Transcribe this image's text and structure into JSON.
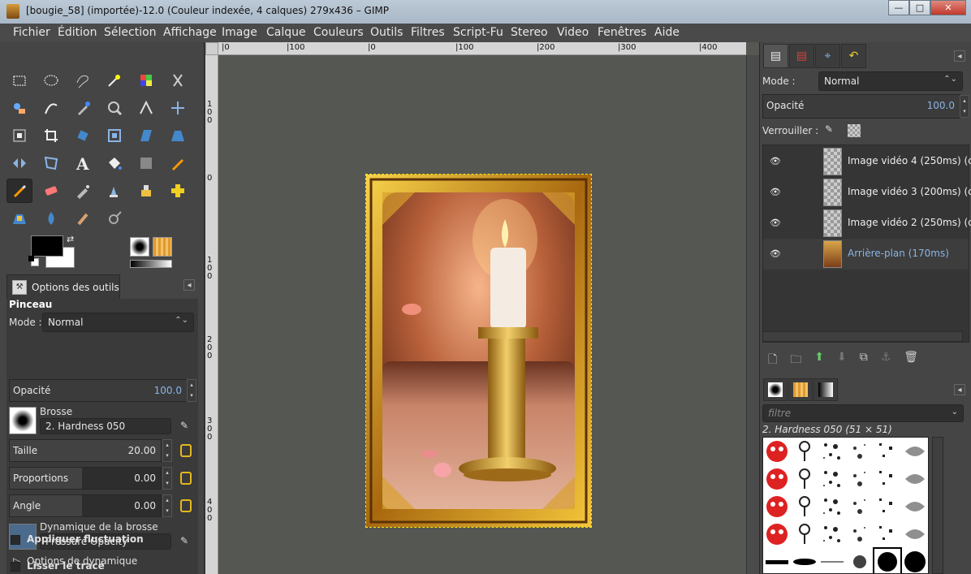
{
  "window": {
    "title": "[bougie_58] (importée)-12.0 (Couleur indexée, 4 calques) 279x436 – GIMP",
    "controls": {
      "minimize": "—",
      "maximize": "□",
      "close": "✕"
    }
  },
  "menu": [
    "Fichier",
    "Édition",
    "Sélection",
    "Affichage",
    "Image",
    "Calque",
    "Couleurs",
    "Outils",
    "Filtres",
    "Script-Fu",
    "Stereo",
    "Video",
    "Fenêtres",
    "Aide"
  ],
  "tools": [
    "rect-select-icon",
    "ellipse-select-icon",
    "free-select-icon",
    "fuzzy-select-icon",
    "color-select-icon",
    "scissors-icon",
    "foreground-select-icon",
    "paths-icon",
    "color-picker-icon",
    "zoom-icon",
    "measure-icon",
    "move-icon",
    "align-icon",
    "crop-icon",
    "rotate-icon",
    "scale-icon",
    "shear-icon",
    "perspective-icon",
    "flip-icon",
    "cage-icon",
    "text-icon",
    "bucket-fill-icon",
    "blend-icon",
    "pencil-icon",
    "paintbrush-icon",
    "eraser-icon",
    "airbrush-icon",
    "ink-icon",
    "clone-icon",
    "heal-icon",
    "perspective-clone-icon",
    "blur-icon",
    "smudge-icon",
    "dodge-burn-icon"
  ],
  "tool_options": {
    "tab_label": "Options des outils",
    "tool_name": "Pinceau",
    "mode_label": "Mode :",
    "mode_value": "Normal",
    "opacity_label": "Opacité",
    "opacity_value": "100.0",
    "brush_label": "Brosse",
    "brush_value": "2. Hardness 050",
    "size_label": "Taille",
    "size_value": "20.00",
    "aspect_label": "Proportions",
    "aspect_value": "0.00",
    "angle_label": "Angle",
    "angle_value": "0.00",
    "dynamics_label": "Dynamique de la brosse",
    "dynamics_value": "Pressure Opacity",
    "dynamics_options_label": "Options de dynamique",
    "jitter_label": "Appliquer fluctuation",
    "smooth_label": "Lisser le tracé"
  },
  "canvas": {
    "hruler_ticks": [
      "|0",
      "|100",
      "|0",
      "|100",
      "|200",
      "|300",
      "|400"
    ],
    "vruler_ticks": [
      "1 0 0",
      "0",
      "1 0 0",
      "2 0 0",
      "3 0 0",
      "4 0 0"
    ]
  },
  "layers_panel": {
    "mode_label": "Mode :",
    "mode_value": "Normal",
    "opacity_label": "Opacité",
    "opacity_value": "100.0",
    "lock_label": "Verrouiller :",
    "layers": [
      {
        "name": "Image vidéo 4 (250ms) (co",
        "selected": false
      },
      {
        "name": "Image vidéo 3 (200ms) (co",
        "selected": false
      },
      {
        "name": "Image vidéo 2 (250ms) (co",
        "selected": false
      },
      {
        "name": "Arrière-plan (170ms)",
        "selected": true
      }
    ]
  },
  "brushes_panel": {
    "filter_placeholder": "filtre",
    "selected_brush_info": "2. Hardness 050 (51 × 51)"
  },
  "colors": {
    "titlebar": "#b3c1cf",
    "accent_blue": "#8ab4e6",
    "foreground": "#000000",
    "background": "#ffffff",
    "canvas_bg": "#555753"
  }
}
